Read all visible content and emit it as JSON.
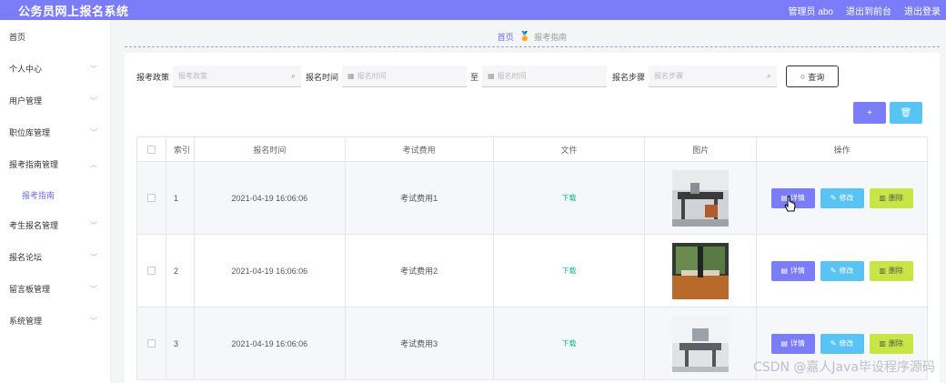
{
  "app": {
    "title": "公务员网上报名系统",
    "user_label": "管理员 abo",
    "frontend_link": "退出到前台",
    "logout_link": "退出登录"
  },
  "sidebar": {
    "items": [
      {
        "label": "首页"
      },
      {
        "label": "个人中心"
      },
      {
        "label": "用户管理"
      },
      {
        "label": "职位库管理"
      },
      {
        "label": "报考指南管理"
      },
      {
        "label": "报考指南"
      },
      {
        "label": "考生报名管理"
      },
      {
        "label": "报名论坛"
      },
      {
        "label": "留言板管理"
      },
      {
        "label": "系统管理"
      }
    ]
  },
  "breadcrumb": {
    "home": "首页",
    "current": "报考指南"
  },
  "search": {
    "policy_label": "报考政策",
    "policy_placeholder": "报考政策",
    "time_label": "报名时间",
    "time_from_placeholder": "报名时间",
    "to_label": "至",
    "time_to_placeholder": "报名时间",
    "steps_label": "报名步骤",
    "steps_placeholder": "报名步骤",
    "query_label": "查询"
  },
  "actions": {
    "add_symbol": "+",
    "delete_symbol": "🗑"
  },
  "table": {
    "headers": [
      "",
      "索引",
      "报名时间",
      "考试费用",
      "文件",
      "图片",
      "操作"
    ],
    "rows": [
      {
        "index": "1",
        "time": "2021-04-19 16:06:06",
        "fee": "考试费用1",
        "file": "下载"
      },
      {
        "index": "2",
        "time": "2021-04-19 16:06:06",
        "fee": "考试费用2",
        "file": "下载"
      },
      {
        "index": "3",
        "time": "2021-04-19 16:06:06",
        "fee": "考试费用3",
        "file": "下载"
      }
    ],
    "ops": {
      "detail": "详情",
      "edit": "修改",
      "delete": "删除"
    }
  },
  "watermark": "CSDN @嘉人Java毕设程序源码",
  "colors": {
    "primary": "#7b7cf7",
    "info": "#59c4f4",
    "warn": "#c9e545",
    "success": "#19b390"
  }
}
